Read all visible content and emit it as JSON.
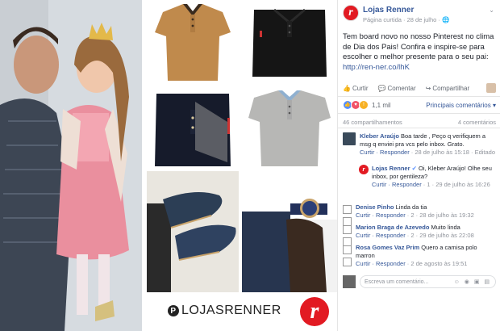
{
  "image": {
    "pinterest_handle": "LOJASRENNER",
    "logo_letter": "r"
  },
  "post": {
    "page_name": "Lojas Renner",
    "page_meta": "Página curtida · 28 de julho ·",
    "text": "Tem board novo no nosso Pinterest no clima de Dia dos Pais! Confira e inspire-se para escolher o melhor presente para o seu pai: ",
    "link": "http://ren-ner.co/lhK",
    "actions": {
      "like": "Curtir",
      "comment": "Comentar",
      "share": "Compartilhar"
    },
    "reactions_count": "1,1 mil",
    "sort_label": "Principais comentários ▾",
    "shares": "46 compartilhamentos",
    "comments_count": "4 comentários"
  },
  "comments": [
    {
      "name": "Kleber Araújo",
      "text": "Boa tarde , Peço q verifiquem a msg q enviei pra vcs pelo inbox. Grato.",
      "meta_actions": "Curtir · Responder",
      "meta_time": " · 28 de julho às 15:18 · Editado",
      "reply": {
        "name": "Lojas Renner",
        "text": "Oi, Kleber Araújo! Olhe seu inbox, por gentileza?",
        "meta_actions": "Curtir · Responder",
        "meta_time": " · 1 · 29 de julho às 16:26"
      }
    },
    {
      "name": "Denise Pinho",
      "text": "Linda da tia",
      "meta_actions": "Curtir · Responder",
      "meta_time": " · 2 · 28 de julho às 19:32"
    },
    {
      "name": "Marion Braga de Azevedo",
      "text": "Muito linda",
      "meta_actions": "Curtir · Responder",
      "meta_time": " · 2 · 29 de julho às 22:08"
    },
    {
      "name": "Rosa Gomes Vaz Prim",
      "text": "Quero a camisa polo marron",
      "meta_actions": "Curtir · Responder",
      "meta_time": " · 2 de agosto às 19:51"
    }
  ],
  "composer": {
    "placeholder": "Escreva um comentário..."
  },
  "colors": {
    "brand_red": "#e21a22",
    "fb_link": "#365899"
  }
}
